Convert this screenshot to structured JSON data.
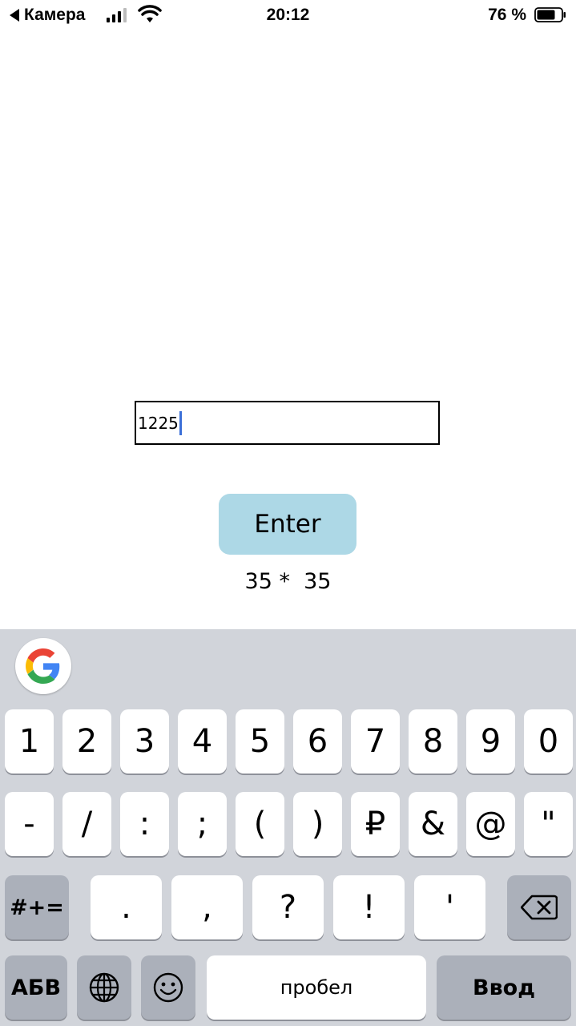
{
  "status_bar": {
    "back_label": "Камера",
    "time": "20:12",
    "battery_percent": "76 %",
    "battery_level": 0.76
  },
  "main": {
    "input_value": "1225",
    "enter_label": "Enter",
    "result_text": "35 *  35"
  },
  "keyboard": {
    "row1": [
      "1",
      "2",
      "3",
      "4",
      "5",
      "6",
      "7",
      "8",
      "9",
      "0"
    ],
    "row2": [
      "-",
      "/",
      ":",
      ";",
      "(",
      ")",
      "₽",
      "&",
      "@",
      "\""
    ],
    "row3": [
      ".",
      ",",
      "?",
      "!",
      "'"
    ],
    "symbols_toggle": "#+=",
    "abc_label": "АБВ",
    "space_label": "пробел",
    "return_label": "Ввод"
  }
}
